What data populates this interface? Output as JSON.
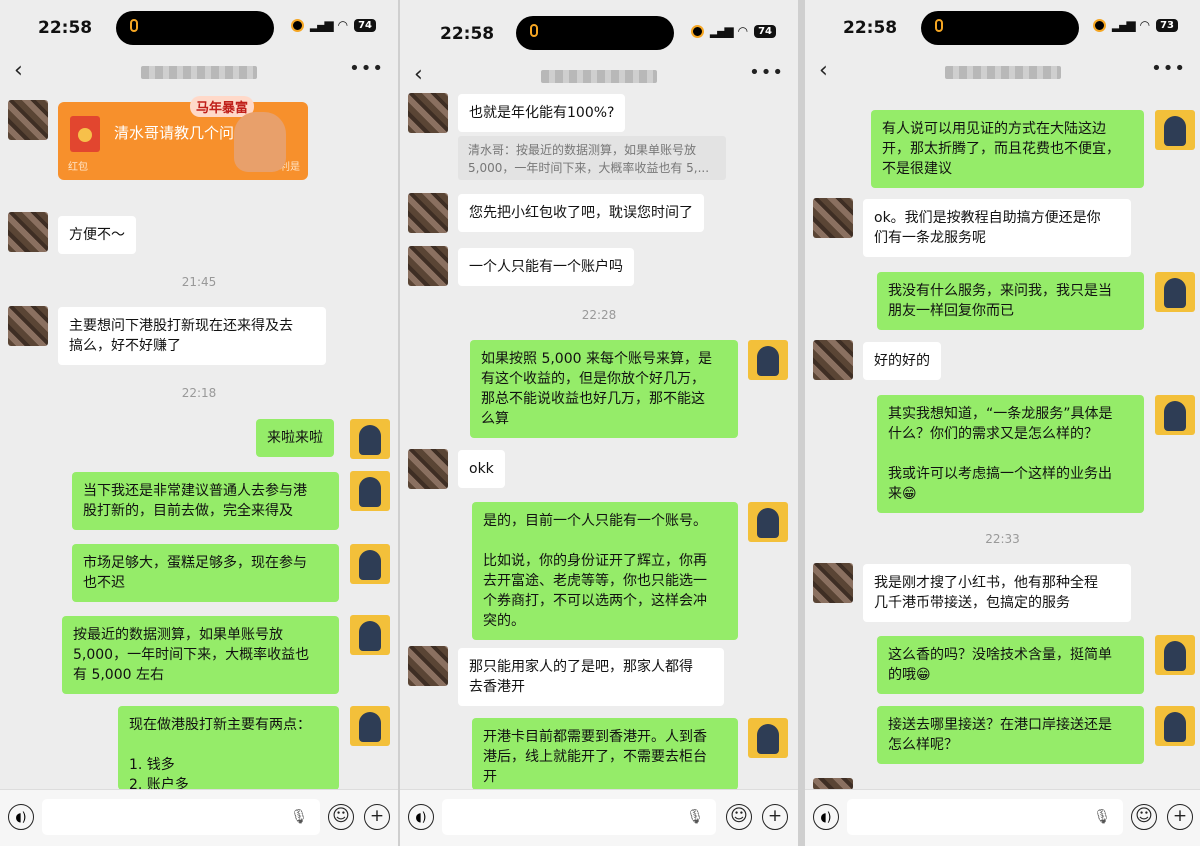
{
  "panels": [
    {
      "time": "22:58",
      "battery": "74",
      "red_packet": {
        "title": "清水哥请教几个问题",
        "label": "红包",
        "deco": "马年暴富",
        "label2": "利是"
      },
      "messages": {
        "m1": "方便不～",
        "ts1": "21:45",
        "m2": "主要想问下港股打新现在还来得及去\n搞么，好不好赚了",
        "ts2": "22:18",
        "m3": "来啦来啦",
        "m4": "当下我还是非常建议普通人去参与港\n股打新的，目前去做，完全来得及",
        "m5": "市场足够大，蛋糕足够多，现在参与\n也不迟",
        "m6": "按最近的数据测算，如果单账号放\n5,000，一年时间下来，大概率收益也\n有 5,000 左右",
        "m7": "现在做港股打新主要有两点：\n\n1. 钱多\n2. 账户多"
      }
    },
    {
      "time": "22:58",
      "battery": "74",
      "messages": {
        "m1": "也就是年化能有100%?",
        "q1": "清水哥：按最近的数据测算，如果单账号放\n5,000，一年时间下来，大概率收益也有 5,...",
        "m2": "您先把小红包收了吧，耽误您时间了",
        "m3": "一个人只能有一个账户吗",
        "ts1": "22:28",
        "m4": "如果按照 5,000 来每个账号来算，是\n有这个收益的，但是你放个好几万，\n那总不能说收益也好几万，那不能这\n么算",
        "m5": "okk",
        "m6": "是的，目前一个人只能有一个账号。\n\n比如说，你的身份证开了辉立，你再\n去开富途、老虎等等，你也只能选一\n个券商打，不可以选两个，这样会冲\n突的。",
        "m7": "那只能用家人的了是吧，那家人都得\n去香港开",
        "m8": "开港卡目前都需要到香港开。人到香\n港后，线上就能开了，不需要去柜台\n开"
      }
    },
    {
      "time": "22:58",
      "battery": "73",
      "messages": {
        "m1": "有人说可以用见证的方式在大陆这边\n开，那太折腾了，而且花费也不便宜，\n不是很建议",
        "m2": "ok。我们是按教程自助搞方便还是你\n们有一条龙服务呢",
        "m3": "我没有什么服务，来问我，我只是当\n朋友一样回复你而已",
        "m4": "好的好的",
        "m5": "其实我想知道，“一条龙服务”具体是\n什么？你们的需求又是怎么样的？\n\n我或许可以考虑搞一个这样的业务出\n来😁",
        "ts1": "22:33",
        "m6": "我是刚才搜了小红书，他有那种全程\n几千港币带接送，包搞定的服务",
        "m7": "这么香的吗？没啥技术含量，挺简单\n的哦😁",
        "m8": "接送去哪里接送？在港口岸接送还是\n怎么样呢？"
      }
    }
  ],
  "icons": [
    "back-icon",
    "more-icon",
    "voice-icon",
    "mic-icon",
    "emoji-icon",
    "plus-icon",
    "signal-icon",
    "wifi-icon",
    "battery-icon"
  ]
}
